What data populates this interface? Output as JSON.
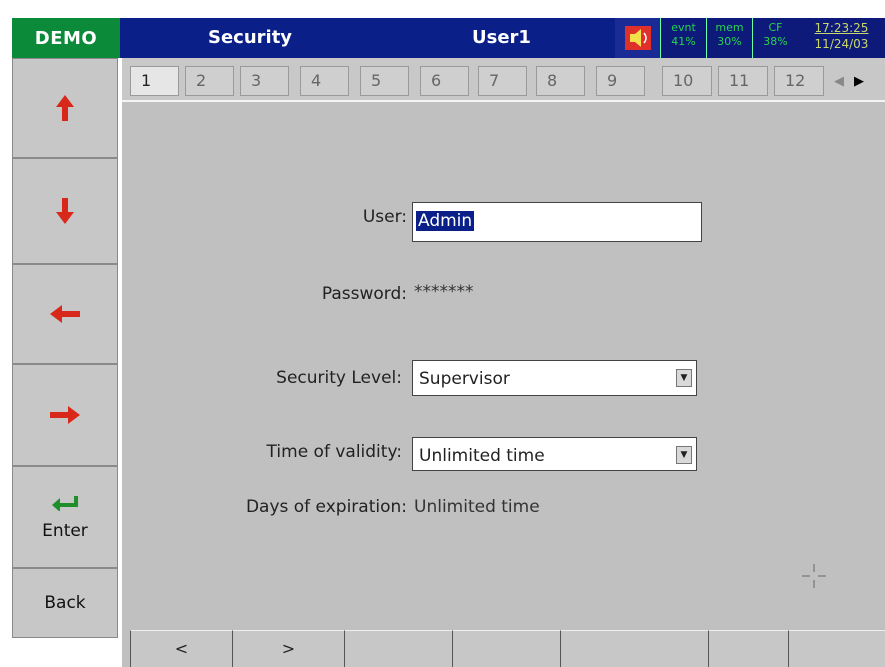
{
  "header": {
    "demo": "DEMO",
    "title": "Security",
    "user": "User1",
    "stats": [
      {
        "label": "evnt",
        "value": "41%"
      },
      {
        "label": "mem",
        "value": "30%"
      },
      {
        "label": "CF",
        "value": "38%"
      }
    ],
    "time": "17:23:25",
    "date": "11/24/03"
  },
  "sidebar": {
    "enter_label": "Enter",
    "back_label": "Back"
  },
  "tabs": [
    "1",
    "2",
    "3",
    "4",
    "5",
    "6",
    "7",
    "8",
    "9",
    "10",
    "11",
    "12"
  ],
  "form": {
    "user_label": "User:",
    "user_value": "Admin",
    "password_label": "Password:",
    "password_value": "*******",
    "security_level_label": "Security Level:",
    "security_level_value": "Supervisor",
    "validity_label": "Time of validity:",
    "validity_value": "Unlimited time",
    "expiration_label": "Days of expiration:",
    "expiration_value": "Unlimited time"
  },
  "bottom": {
    "prev_label": "<",
    "next_label": ">"
  },
  "colors": {
    "demo_bg": "#0b8a3a",
    "titlebar_bg": "#0a1f88",
    "arrow_red": "#d8281a",
    "enter_green": "#1f8f2c"
  }
}
